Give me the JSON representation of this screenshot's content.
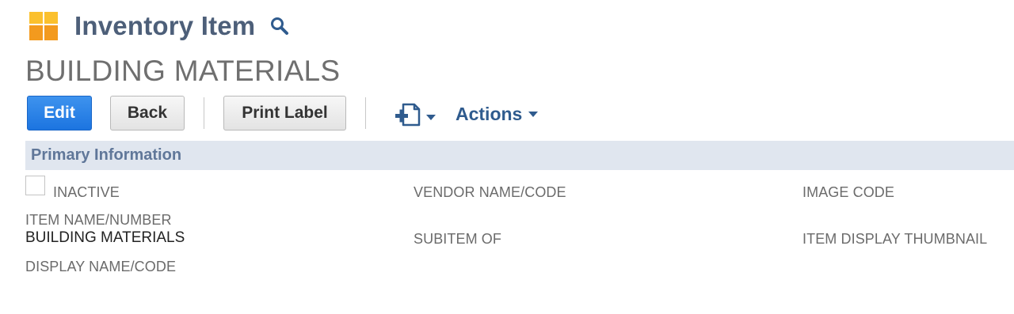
{
  "header": {
    "record_type": "Inventory Item",
    "record_name": "BUILDING MATERIALS"
  },
  "icons": {
    "record_icon": "inventory-box-icon",
    "search": "search-icon",
    "new_record": "new-record-icon",
    "dropdown": "caret-down-icon"
  },
  "toolbar": {
    "edit_label": "Edit",
    "back_label": "Back",
    "print_label": "Print Label",
    "actions_label": "Actions"
  },
  "section": {
    "title": "Primary Information"
  },
  "fields": {
    "inactive_label": "INACTIVE",
    "inactive_checked": false,
    "item_name_label": "ITEM NAME/NUMBER",
    "item_name_value": "BUILDING MATERIALS",
    "display_name_label": "DISPLAY NAME/CODE",
    "vendor_name_label": "VENDOR NAME/CODE",
    "subitem_of_label": "SUBITEM OF",
    "image_code_label": "IMAGE CODE",
    "item_display_thumbnail_label": "ITEM DISPLAY THUMBNAIL"
  },
  "colors": {
    "primary_button": "#2a82e8",
    "title_text": "#4d5f79",
    "link_text": "#2f5b8e",
    "section_bg": "#e0e6ef",
    "icon_orange": "#f39a1e",
    "icon_yellow": "#fbbf2e"
  }
}
